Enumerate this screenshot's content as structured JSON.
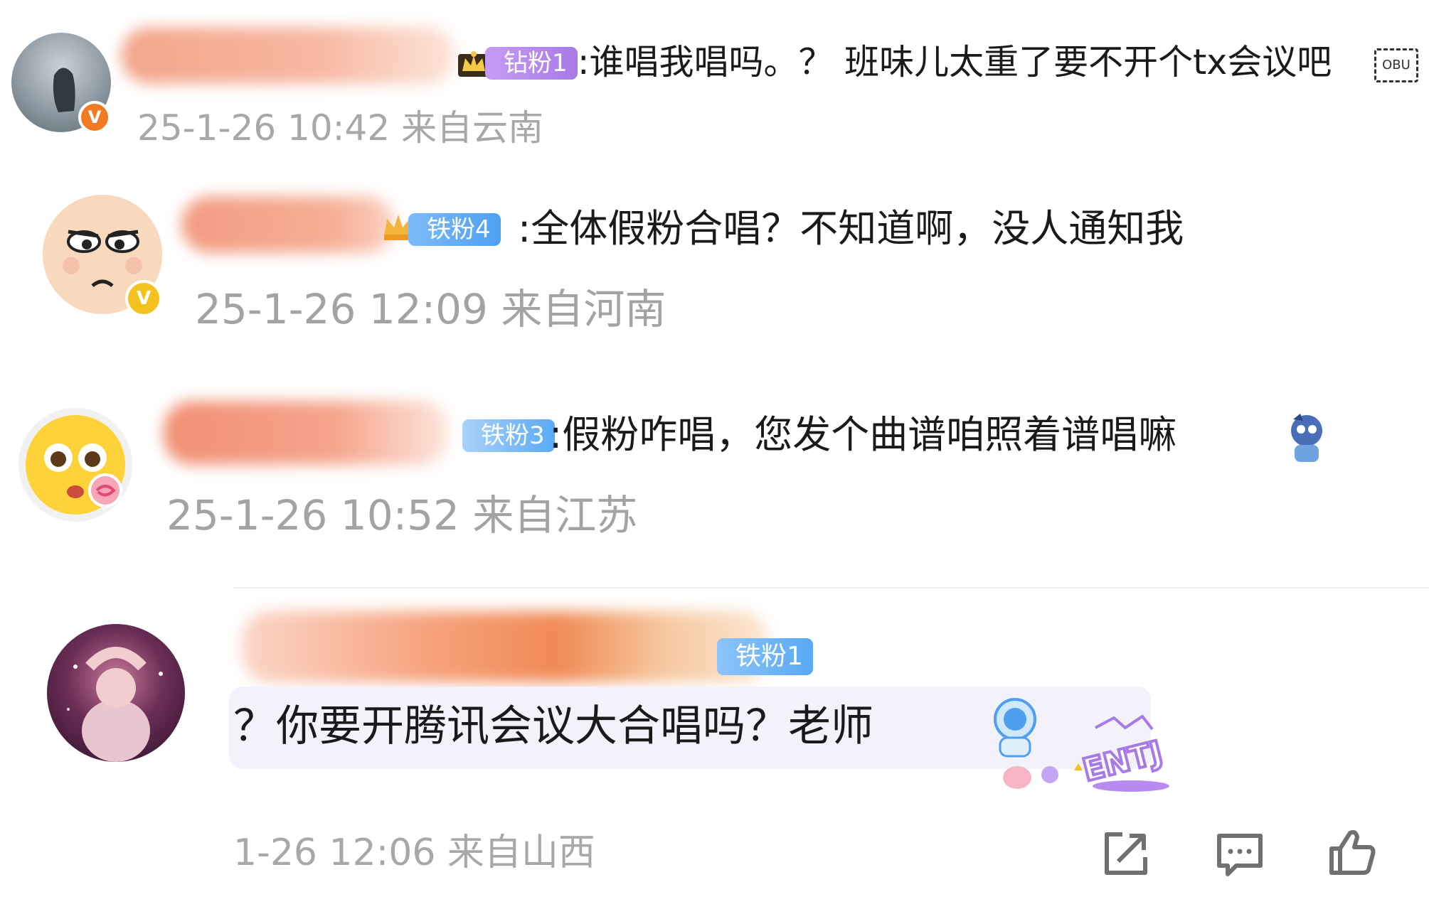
{
  "comments": [
    {
      "badge": "钻粉1",
      "text": ":谁唱我唱吗。？ 班味儿太重了要不开个tx会议吧",
      "emoji_tail": "OBU",
      "meta": "25-1-26 10:42 来自云南",
      "verified": "V"
    },
    {
      "badge": "铁粉4",
      "text": ":全体假粉合唱？不知道啊，没人通知我",
      "meta": "25-1-26 12:09 来自河南",
      "verified": "V"
    },
    {
      "badge": "铁粉3",
      "text": ":假粉咋唱，您发个曲谱咱照着谱唱嘛",
      "meta": "25-1-26 10:52 来自江苏"
    }
  ],
  "main_comment": {
    "badge": "铁粉1",
    "text": "？你要开腾讯会议大合唱吗？老师",
    "sticker_text": "ENTJ",
    "meta": "1-26 12:06 来自山西"
  },
  "actions": {
    "share_icon": "share-icon",
    "comment_icon": "comment-icon",
    "like_icon": "like-icon"
  },
  "colors": {
    "blur_name": "#f2a48c",
    "badge_purple": "#b98af0",
    "badge_blue": "#5aa9f5",
    "meta_gray": "#a8a8a8",
    "verified_orange": "#f07b22",
    "verified_gold": "#f3c21f",
    "bubble": "#f3f1fa"
  }
}
